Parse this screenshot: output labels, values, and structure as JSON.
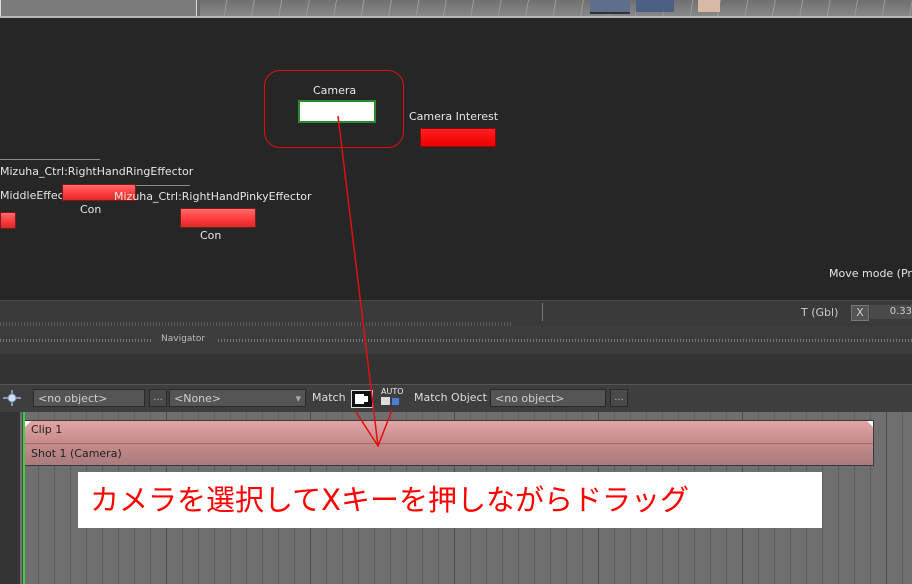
{
  "schematic": {
    "nodes": {
      "camera": "Camera",
      "camera_interest": "Camera Interest",
      "ring_effector": "Mizuha_Ctrl:RightHandRingEffector",
      "middle_effector": "MiddleEffect",
      "pinky_effector": "Mizuha_Ctrl:RightHandPinkyEffector",
      "con_1": "Con",
      "con_2": "Con"
    },
    "move_mode": "Move mode (Pr"
  },
  "property_strip": {
    "transform_label": "T (Gbl)",
    "axis_x": "X",
    "value_x": "0.33"
  },
  "navigator": {
    "label": "Navigator"
  },
  "story_toolbar": {
    "object_field": "<no object>",
    "browse_1": "...",
    "none_field": "<None>",
    "dropdown_glyph": "▾",
    "match_label": "Match",
    "auto_label": "AUTO",
    "match_object_label": "Match Object",
    "match_object_field": "<no object>",
    "browse_2": "..."
  },
  "timeline": {
    "clip_label": "Clip 1",
    "shot_label": "Shot 1 (Camera)"
  },
  "annotation": {
    "caption": "カメラを選択してXキーを押しながらドラッグ",
    "color": "#ff0000"
  }
}
